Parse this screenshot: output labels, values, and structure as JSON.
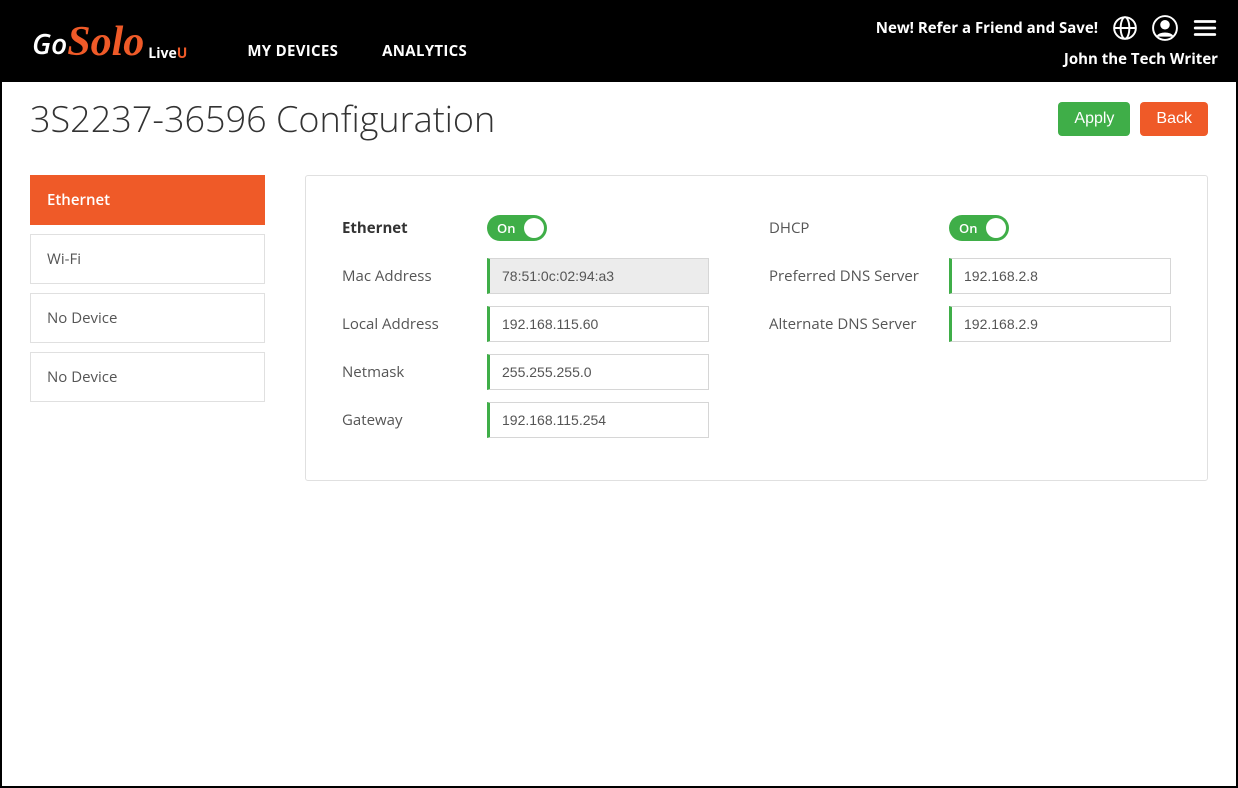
{
  "header": {
    "logo_go": "Go",
    "logo_solo": "Solo",
    "logo_live": "Live",
    "logo_u": "U",
    "nav": {
      "my_devices": "MY DEVICES",
      "analytics": "ANALYTICS"
    },
    "promo": "New! Refer a Friend and Save!",
    "username": "John the Tech Writer"
  },
  "page": {
    "title": "3S2237-36596 Configuration",
    "apply_label": "Apply",
    "back_label": "Back"
  },
  "sidebar": {
    "items": [
      {
        "label": "Ethernet",
        "active": true
      },
      {
        "label": "Wi-Fi"
      },
      {
        "label": "No Device"
      },
      {
        "label": "No Device"
      }
    ]
  },
  "form": {
    "ethernet_label": "Ethernet",
    "ethernet_toggle": "On",
    "mac_label": "Mac Address",
    "mac_value": "78:51:0c:02:94:a3",
    "local_label": "Local Address",
    "local_value": "192.168.115.60",
    "netmask_label": "Netmask",
    "netmask_value": "255.255.255.0",
    "gateway_label": "Gateway",
    "gateway_value": "192.168.115.254",
    "dhcp_label": "DHCP",
    "dhcp_toggle": "On",
    "pref_dns_label": "Preferred DNS Server",
    "pref_dns_value": "192.168.2.8",
    "alt_dns_label": "Alternate DNS Server",
    "alt_dns_value": "192.168.2.9"
  }
}
